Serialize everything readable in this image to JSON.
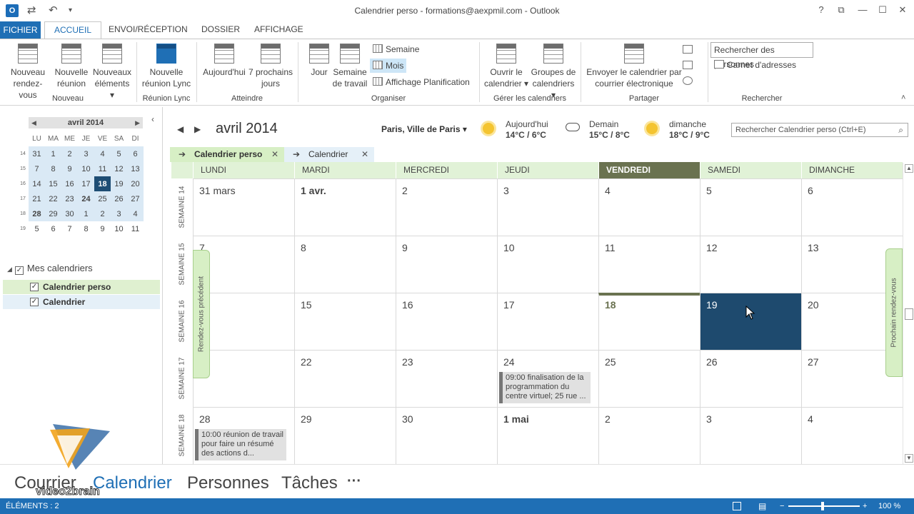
{
  "window": {
    "title": "Calendrier perso - formations@aexpmil.com - Outlook",
    "app_icon_label": "O",
    "help": "?",
    "restore_ribbon": "⧉",
    "minimize": "—",
    "maximize": "☐",
    "close": "✕"
  },
  "quick_access": {
    "send_receive": "⇄",
    "undo": "↶",
    "customize": "▾"
  },
  "tabs": {
    "file": "FICHIER",
    "home": "ACCUEIL",
    "send_receive": "ENVOI/RÉCEPTION",
    "folder": "DOSSIER",
    "view": "AFFICHAGE"
  },
  "ribbon": {
    "nouveau": {
      "label": "Nouveau",
      "new_appt_1": "Nouveau",
      "new_appt_2": "rendez-vous",
      "new_meeting_1": "Nouvelle",
      "new_meeting_2": "réunion",
      "new_items_1": "Nouveaux",
      "new_items_2": "éléments ▾"
    },
    "lync": {
      "label": "Réunion Lync",
      "btn_1": "Nouvelle",
      "btn_2": "réunion Lync"
    },
    "atteindre": {
      "label": "Atteindre",
      "today": "Aujourd'hui",
      "next7_1": "7 prochains",
      "next7_2": "jours"
    },
    "organiser": {
      "label": "Organiser",
      "day": "Jour",
      "work_week_1": "Semaine",
      "work_week_2": "de travail",
      "week": "Semaine",
      "month": "Mois",
      "schedule_view": "Affichage Planification"
    },
    "gerer": {
      "label": "Gérer les calendriers",
      "open_1": "Ouvrir le",
      "open_2": "calendrier ▾",
      "groups_1": "Groupes de",
      "groups_2": "calendriers ▾"
    },
    "partager": {
      "label": "Partager",
      "email_1": "Envoyer le calendrier par",
      "email_2": "courrier électronique"
    },
    "rechercher": {
      "label": "Rechercher",
      "search_people": "Rechercher des personnes",
      "address_book": "Carnet d'adresses"
    }
  },
  "mini_calendar": {
    "month_label": "avril 2014",
    "prev": "◀",
    "next": "▶",
    "dow": [
      "LU",
      "MA",
      "ME",
      "JE",
      "VE",
      "SA",
      "DI"
    ],
    "weeks": [
      {
        "wk": "14",
        "days": [
          "31",
          "1",
          "2",
          "3",
          "4",
          "5",
          "6"
        ]
      },
      {
        "wk": "15",
        "days": [
          "7",
          "8",
          "9",
          "10",
          "11",
          "12",
          "13"
        ]
      },
      {
        "wk": "16",
        "days": [
          "14",
          "15",
          "16",
          "17",
          "18",
          "19",
          "20"
        ]
      },
      {
        "wk": "17",
        "days": [
          "21",
          "22",
          "23",
          "24",
          "25",
          "26",
          "27"
        ]
      },
      {
        "wk": "18",
        "days": [
          "28",
          "29",
          "30",
          "1",
          "2",
          "3",
          "4"
        ]
      },
      {
        "wk": "19",
        "days": [
          "5",
          "6",
          "7",
          "8",
          "9",
          "10",
          "11"
        ]
      }
    ]
  },
  "calendars": {
    "group_label": "Mes calendriers",
    "items": [
      "Calendrier perso",
      "Calendrier"
    ]
  },
  "calendar_view": {
    "month_title": "avril 2014",
    "location": "Paris, Ville de Paris ▾",
    "weather": [
      {
        "day": "Aujourd'hui",
        "temp": "14°C / 6°C"
      },
      {
        "day": "Demain",
        "temp": "15°C / 8°C"
      },
      {
        "day": "dimanche",
        "temp": "18°C / 9°C"
      }
    ],
    "search_placeholder": "Rechercher Calendrier perso (Ctrl+E)",
    "tabs": [
      "Calendrier perso",
      "Calendrier"
    ],
    "day_headers": [
      "LUNDI",
      "MARDI",
      "MERCREDI",
      "JEUDI",
      "VENDREDI",
      "SAMEDI",
      "DIMANCHE"
    ],
    "week_labels": [
      "SEMAINE 14",
      "SEMAINE 15",
      "SEMAINE 16",
      "SEMAINE 17",
      "SEMAINE 18"
    ],
    "rows": [
      [
        "31 mars",
        "1 avr.",
        "2",
        "3",
        "4",
        "5",
        "6"
      ],
      [
        "7",
        "8",
        "9",
        "10",
        "11",
        "12",
        "13"
      ],
      [
        "",
        "15",
        "16",
        "17",
        "18",
        "19",
        "20"
      ],
      [
        "",
        "22",
        "23",
        "24",
        "25",
        "26",
        "27"
      ],
      [
        "28",
        "29",
        "30",
        "1 mai",
        "2",
        "3",
        "4"
      ]
    ],
    "appointments": {
      "a24": "09:00 finalisation de la programmation du centre virtuel; 25 rue ...",
      "a28": "10:00 réunion de travail pour faire un résumé des actions d..."
    },
    "prev_appt": "Rendez-vous précédent",
    "next_appt": "Prochain rendez-vous"
  },
  "bottom_nav": {
    "mail": "Courrier",
    "calendar": "Calendrier",
    "people": "Personnes",
    "tasks": "Tâches",
    "more": "···"
  },
  "watermark": "video2brain",
  "statusbar": {
    "items": "ÉLÉMENTS : 2",
    "zoom": "100 %"
  },
  "colors": {
    "accent": "#1f6fb5",
    "today_header": "#6a7250",
    "selected_day": "#1e4a6e",
    "day_header_bg": "#e1f2d7"
  }
}
